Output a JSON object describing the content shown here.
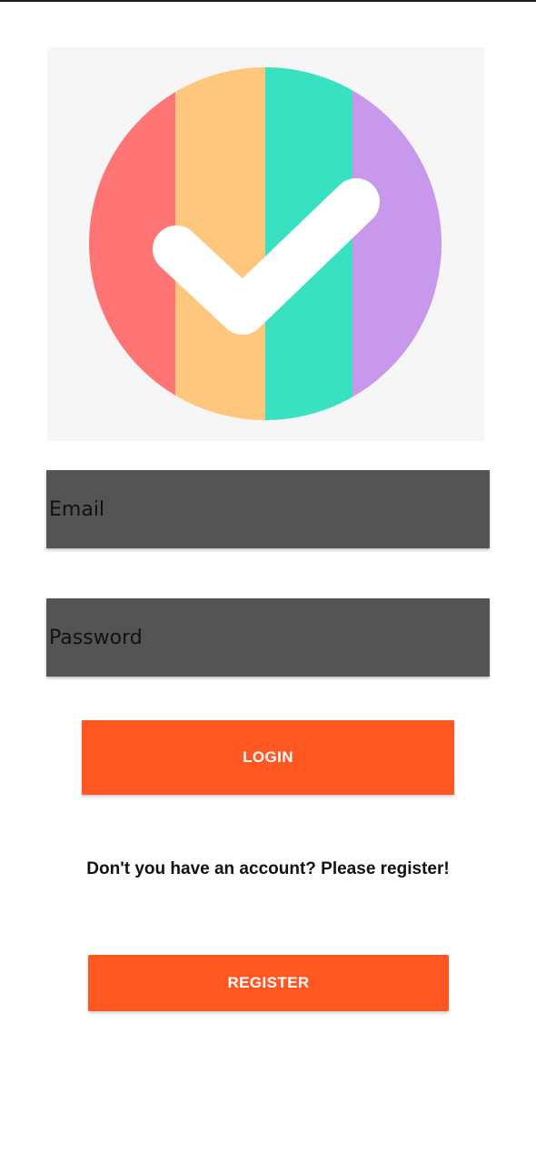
{
  "logo": {
    "icon": "checkmark-circle-icon",
    "colors": [
      "#ff7575",
      "#ffc77e",
      "#38e2c0",
      "#c898ec"
    ],
    "check_color": "#ffffff",
    "background": "#f6f6f6"
  },
  "form": {
    "email_placeholder": "Email",
    "password_placeholder": "Password",
    "field_color": "#545454"
  },
  "actions": {
    "login_label": "LOGIN",
    "register_prompt": "Don't you have an account? Please register!",
    "register_label": "REGISTER",
    "accent_color": "#ff5722"
  }
}
